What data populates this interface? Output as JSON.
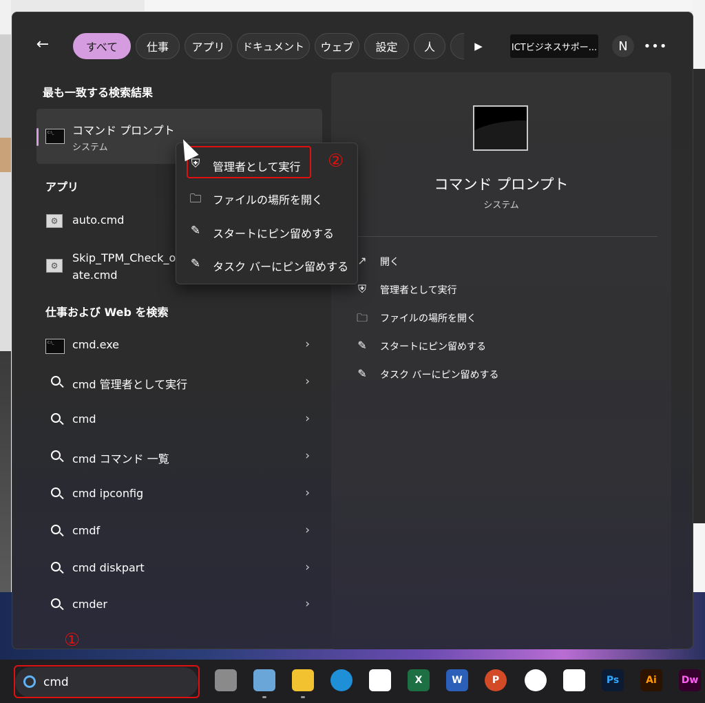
{
  "filters": {
    "back_label": "←",
    "chips": [
      "すべて",
      "仕事",
      "アプリ",
      "ドキュメント",
      "ウェブ",
      "設定",
      "人"
    ],
    "active": "すべて",
    "account_label": "ICTビジネスサポー...",
    "avatar_initial": "N",
    "more_label": "•••"
  },
  "best_match": {
    "heading": "最も一致する検索結果",
    "title": "コマンド プロンプト",
    "subtitle": "システム"
  },
  "apps": {
    "heading": "アプリ",
    "items": [
      {
        "label": "auto.cmd"
      },
      {
        "label_line1": "Skip_TPM_Check_o",
        "label_line2": "ate.cmd"
      }
    ]
  },
  "web": {
    "heading": "仕事および Web を検索",
    "items": [
      {
        "label": "cmd.exe",
        "icon": "cmd-icon"
      },
      {
        "label": "cmd 管理者として実行",
        "icon": "search-icon"
      },
      {
        "label": "cmd",
        "icon": "search-icon"
      },
      {
        "label": "cmd コマンド 一覧",
        "icon": "search-icon"
      },
      {
        "label": "cmd ipconfig",
        "icon": "search-icon"
      },
      {
        "label": "cmdf",
        "icon": "search-icon"
      },
      {
        "label": "cmd diskpart",
        "icon": "search-icon"
      },
      {
        "label": "cmder",
        "icon": "search-icon"
      }
    ],
    "chevron": "›"
  },
  "context_menu": {
    "items": [
      {
        "label": "管理者として実行",
        "icon": "shield-icon"
      },
      {
        "label": "ファイルの場所を開く",
        "icon": "folder-icon"
      },
      {
        "label": "スタートにピン留めする",
        "icon": "pin-icon"
      },
      {
        "label": "タスク バーにピン留めする",
        "icon": "pin-icon"
      }
    ]
  },
  "detail": {
    "title": "コマンド プロンプト",
    "subtitle": "システム",
    "actions": [
      {
        "label": "開く",
        "icon": "open-icon"
      },
      {
        "label": "管理者として実行",
        "icon": "shield-icon"
      },
      {
        "label": "ファイルの場所を開く",
        "icon": "folder-icon"
      },
      {
        "label": "スタートにピン留めする",
        "icon": "pin-icon"
      },
      {
        "label": "タスク バーにピン留めする",
        "icon": "pin-icon"
      }
    ]
  },
  "annotations": {
    "marker1": "①",
    "marker2": "②",
    "highlight_color": "#e01010"
  },
  "taskbar": {
    "search_value": "cmd",
    "apps": [
      {
        "name": "task-view-icon",
        "label": "",
        "color": "#8a8a8a"
      },
      {
        "name": "task-manager-icon",
        "label": "",
        "color": "#6aa7d8"
      },
      {
        "name": "file-explorer-icon",
        "label": "",
        "color": "#f2c230"
      },
      {
        "name": "edge-icon",
        "label": "",
        "color": "#1f8fd8"
      },
      {
        "name": "store-icon",
        "label": "",
        "color": "#ffffff"
      },
      {
        "name": "excel-icon",
        "label": "X",
        "color": "#1d7044"
      },
      {
        "name": "word-icon",
        "label": "W",
        "color": "#2b5fb8"
      },
      {
        "name": "powerpoint-icon",
        "label": "P",
        "color": "#d24a26"
      },
      {
        "name": "photos-icon",
        "label": "",
        "color": "#ffffff"
      },
      {
        "name": "slack-icon",
        "label": "",
        "color": "#ffffff"
      },
      {
        "name": "photoshop-icon",
        "label": "Ps",
        "color": "#0b1b33"
      },
      {
        "name": "illustrator-icon",
        "label": "Ai",
        "color": "#2b1300"
      },
      {
        "name": "dreamweaver-icon",
        "label": "Dw",
        "color": "#35002b"
      }
    ]
  },
  "colors": {
    "accent": "#d69ce0",
    "panel": "#2b2b2b"
  }
}
